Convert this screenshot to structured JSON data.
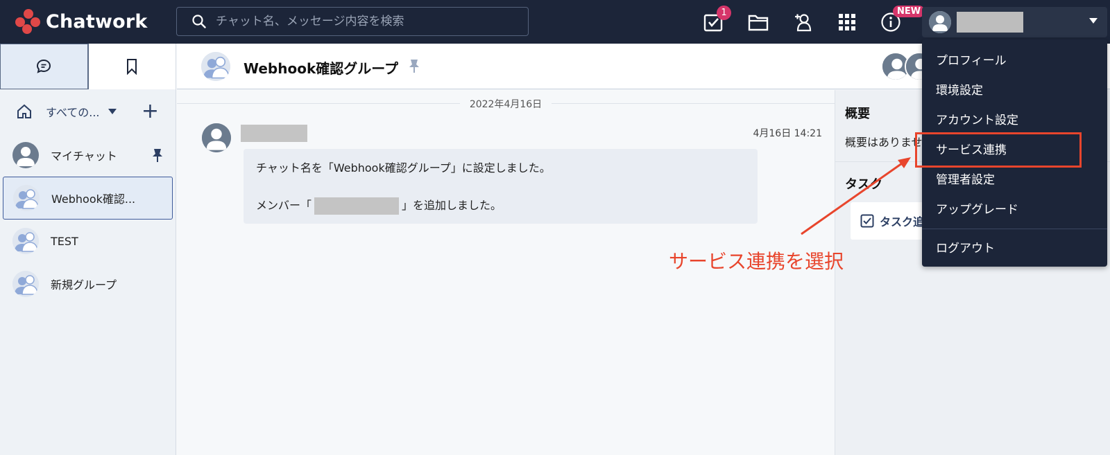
{
  "header": {
    "logo_text": "Chatwork",
    "search_placeholder": "チャット名、メッセージ内容を検索",
    "task_badge": "1",
    "new_badge": "NEW"
  },
  "sidebar": {
    "filter_label": "すべての...",
    "rooms": [
      {
        "name": "マイチャット"
      },
      {
        "name": "Webhook確認..."
      },
      {
        "name": "TEST"
      },
      {
        "name": "新規グループ"
      }
    ]
  },
  "chat": {
    "title": "Webhook確認グループ",
    "date_separator": "2022年4月16日",
    "message_time": "4月16日 14:21",
    "message_line1": "チャット名を「Webhook確認グループ」に設定しました。",
    "message_line2_prefix": "メンバー「",
    "message_line2_suffix": "」を追加しました。"
  },
  "right_panel": {
    "overview_title": "概要",
    "overview_text": "概要はありませ",
    "task_title": "タスク",
    "task_button": "タスク追"
  },
  "account_menu": {
    "items": [
      "プロフィール",
      "環境設定",
      "アカウント設定",
      "サービス連携",
      "管理者設定",
      "アップグレード"
    ],
    "logout": "ログアウト"
  },
  "annotation": {
    "text": "サービス連携を選択",
    "color": "#e8452c"
  },
  "colors": {
    "header_bg": "#1c2539",
    "accent": "#2c3f63",
    "badge": "#d6356a"
  }
}
